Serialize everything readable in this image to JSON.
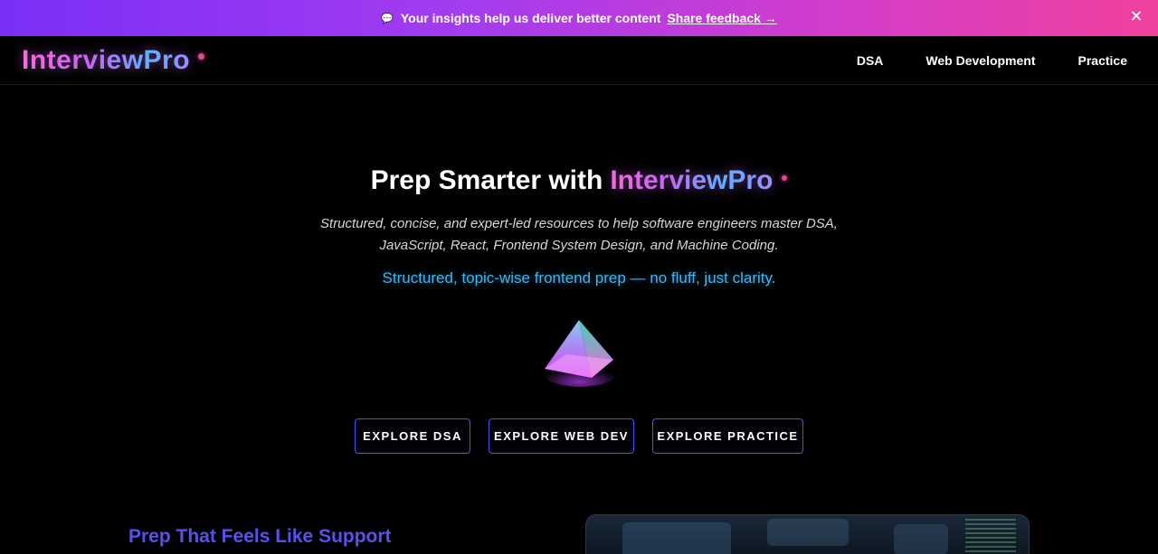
{
  "banner": {
    "icon": "speech-bubble-icon",
    "message": "Your insights help us deliver better content",
    "link": "Share feedback →",
    "close": "✕"
  },
  "nav": {
    "logo": "InterviewPro",
    "links": [
      "DSA",
      "Web Development",
      "Practice"
    ]
  },
  "hero": {
    "title_prefix": "Prep Smarter with",
    "title_brand": "InterviewPro",
    "subtitle": "Structured, concise, and expert-led resources to help software engineers master DSA, JavaScript, React, Frontend System Design, and Machine Coding.",
    "tagline": "Structured, topic-wise frontend prep — no fluff, just clarity.",
    "buttons": [
      "EXPLORE DSA",
      "EXPLORE WEB DEV",
      "EXPLORE PRACTICE"
    ]
  },
  "section": {
    "title": "Prep That Feels Like Support"
  },
  "colors": {
    "banner_start": "#7b2ff7",
    "banner_end": "#f0419d",
    "tagline": "#3fb6ef",
    "button_border": "#4a4dff",
    "section_title": "#5b4ff0"
  }
}
